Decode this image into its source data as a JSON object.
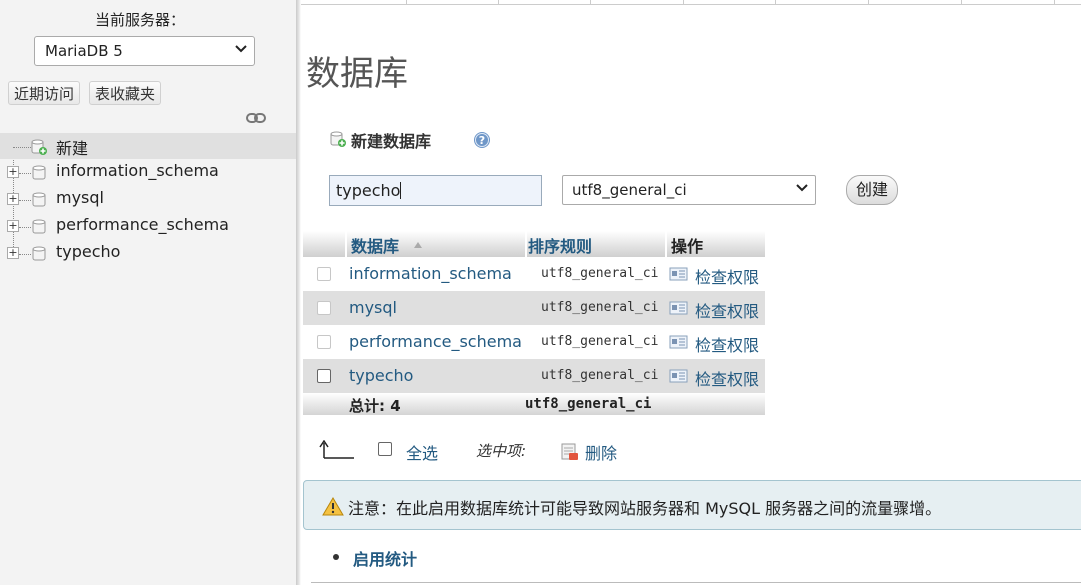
{
  "nav": {
    "server_label": "当前服务器：",
    "server_selected": "MariaDB 5",
    "buttons": {
      "recent": "近期访问",
      "favorites": "表收藏夹"
    },
    "tree": {
      "new_label": "新建",
      "databases": [
        "information_schema",
        "mysql",
        "performance_schema",
        "typecho"
      ]
    }
  },
  "main": {
    "title": "数据库",
    "create": {
      "heading": "新建数据库",
      "name_value": "typecho",
      "collation_selected": "utf8_general_ci",
      "button": "创建"
    },
    "table": {
      "headers": {
        "database": "数据库",
        "collation": "排序规则",
        "action": "操作"
      },
      "rows": [
        {
          "name": "information_schema",
          "collation": "utf8_general_ci",
          "action": "检查权限"
        },
        {
          "name": "mysql",
          "collation": "utf8_general_ci",
          "action": "检查权限"
        },
        {
          "name": "performance_schema",
          "collation": "utf8_general_ci",
          "action": "检查权限"
        },
        {
          "name": "typecho",
          "collation": "utf8_general_ci",
          "action": "检查权限"
        }
      ],
      "footer": {
        "total": "总计: 4",
        "collation": "utf8_general_ci"
      }
    },
    "bulk": {
      "select_all": "全选",
      "with_selected": "选中项:",
      "delete": "删除"
    },
    "notice": "注意：在此启用数据库统计可能导致网站服务器和 MySQL 服务器之间的流量骤增。",
    "enable_stats": "启用统计"
  },
  "colors": {
    "link": "#235a81",
    "nav_bg": "#f3f3f3",
    "notice_bg": "#e6eff2"
  }
}
